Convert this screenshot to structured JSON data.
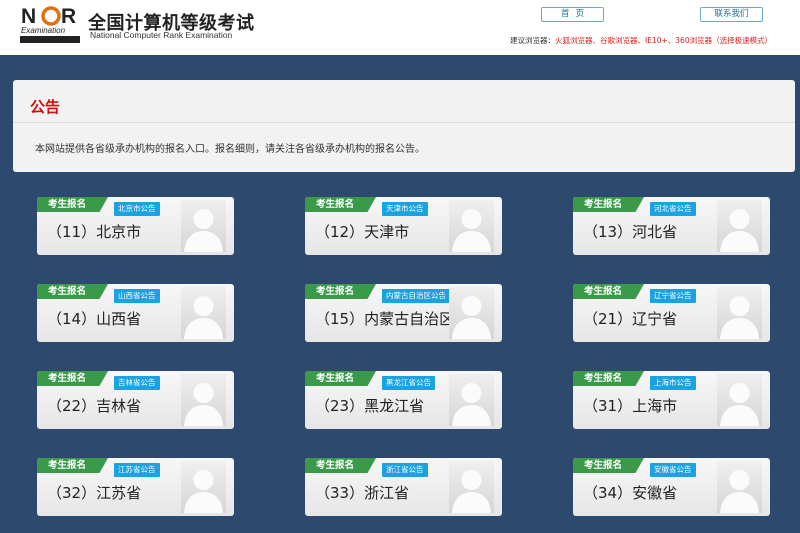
{
  "header": {
    "logo_mark": "NCR",
    "logo_sub": "Examination",
    "title": "全国计算机等级考试",
    "subtitle": "National Computer Rank Examination",
    "home_label": "首页",
    "contact_label": "联系我们",
    "browser_tip_label": "建议浏览器：",
    "browser_tip_value": "火狐浏览器、谷歌浏览器、IE10+、360浏览器（选择极速模式）"
  },
  "notice": {
    "title": "公告",
    "text": "本网站提供各省级承办机构的报名入口。报名细则，请关注各省级承办机构的报名公告。"
  },
  "cards": [
    {
      "tag": "考生报名",
      "notice": "北京市公告",
      "name": "（11）北京市"
    },
    {
      "tag": "考生报名",
      "notice": "天津市公告",
      "name": "（12）天津市"
    },
    {
      "tag": "考生报名",
      "notice": "河北省公告",
      "name": "（13）河北省"
    },
    {
      "tag": "考生报名",
      "notice": "山西省公告",
      "name": "（14）山西省"
    },
    {
      "tag": "考生报名",
      "notice": "内蒙古自治区公告",
      "name": "（15）内蒙古自治区"
    },
    {
      "tag": "考生报名",
      "notice": "辽宁省公告",
      "name": "（21）辽宁省"
    },
    {
      "tag": "考生报名",
      "notice": "吉林省公告",
      "name": "（22）吉林省"
    },
    {
      "tag": "考生报名",
      "notice": "黑龙江省公告",
      "name": "（23）黑龙江省"
    },
    {
      "tag": "考生报名",
      "notice": "上海市公告",
      "name": "（31）上海市"
    },
    {
      "tag": "考生报名",
      "notice": "江苏省公告",
      "name": "（32）江苏省"
    },
    {
      "tag": "考生报名",
      "notice": "浙江省公告",
      "name": "（33）浙江省"
    },
    {
      "tag": "考生报名",
      "notice": "安徽省公告",
      "name": "（34）安徽省"
    }
  ]
}
